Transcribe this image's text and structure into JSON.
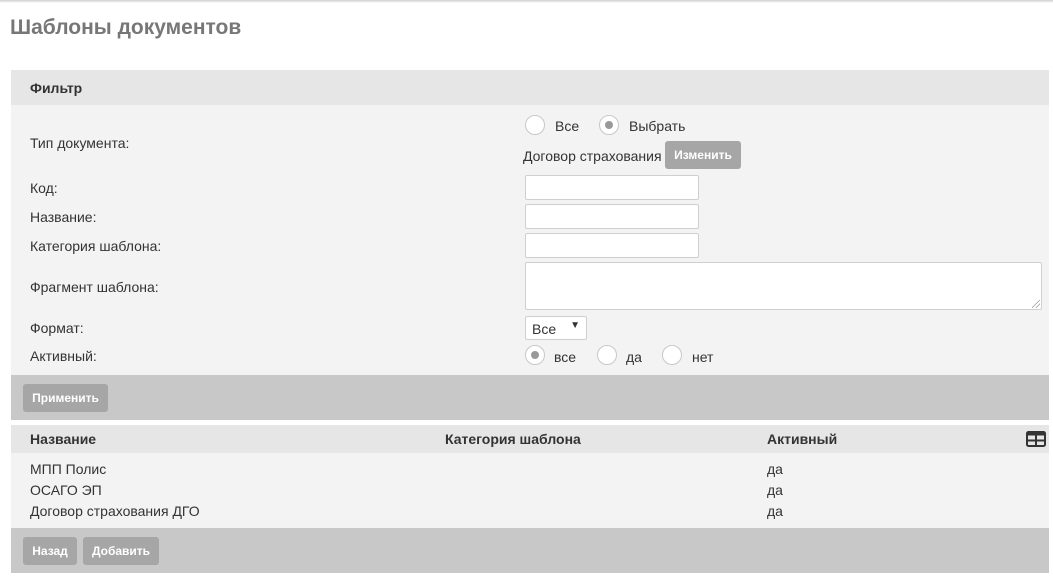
{
  "page": {
    "title": "Шаблоны документов"
  },
  "filter": {
    "title": "Фильтр",
    "doc_type": {
      "label": "Тип документа:",
      "options": [
        "Все",
        "Выбрать"
      ],
      "selected": "Выбрать",
      "selected_value": "Договор страхования",
      "change_button": "Изменить"
    },
    "code": {
      "label": "Код:",
      "value": ""
    },
    "name": {
      "label": "Название:",
      "value": ""
    },
    "category": {
      "label": "Категория шаблона:",
      "value": ""
    },
    "fragment": {
      "label": "Фрагмент шаблона:",
      "value": ""
    },
    "format": {
      "label": "Формат:",
      "value": "Все"
    },
    "active": {
      "label": "Активный:",
      "options": [
        "все",
        "да",
        "нет"
      ],
      "selected": "все"
    },
    "apply_button": "Применить"
  },
  "table": {
    "columns": [
      "Название",
      "Категория шаблона",
      "Активный"
    ],
    "rows": [
      {
        "name": "МПП Полис",
        "category": "",
        "active": "да"
      },
      {
        "name": "ОСАГО ЭП",
        "category": "",
        "active": "да"
      },
      {
        "name": "Договор страхования ДГО",
        "category": "",
        "active": "да"
      }
    ],
    "back_button": "Назад",
    "add_button": "Добавить"
  },
  "colors": {
    "panel_bg": "#f3f3f3",
    "panel_header": "#e6e6e6",
    "footer_bar": "#c8c8c8",
    "button": "#a6a6a6",
    "title_text": "#777777"
  },
  "icons": {
    "columns_toggle": "table-grid-icon"
  }
}
